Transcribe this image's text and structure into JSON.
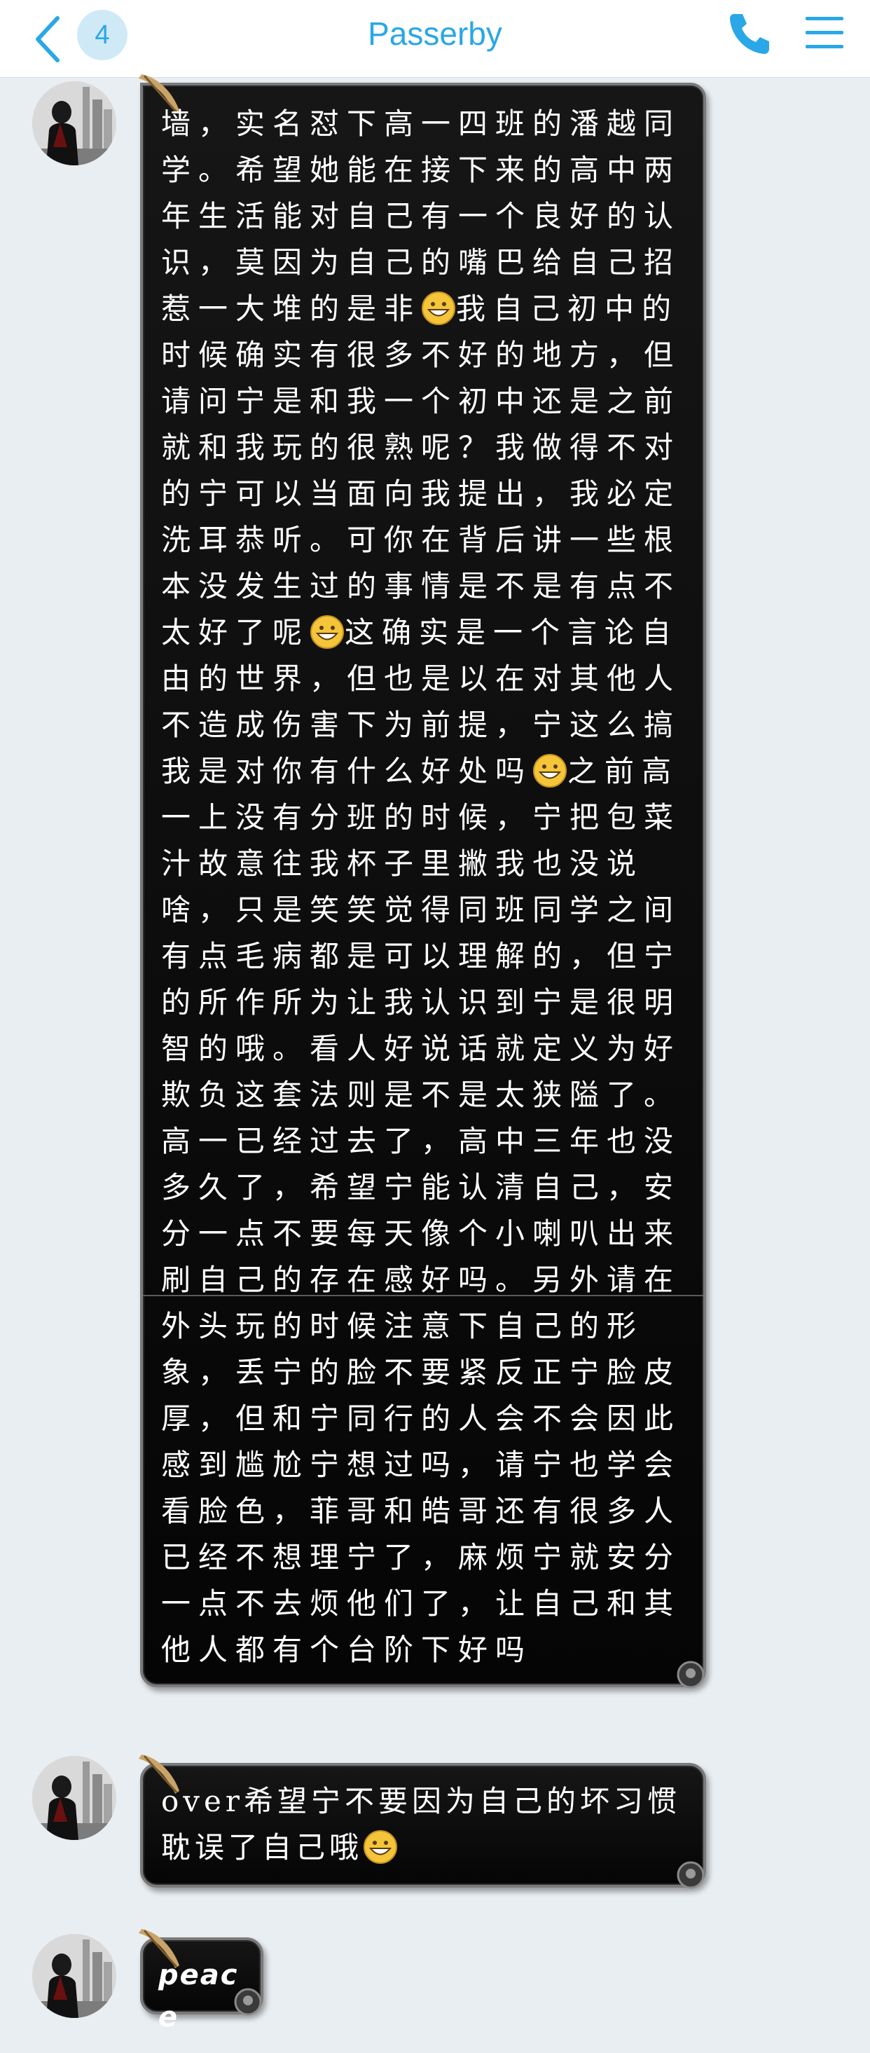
{
  "header": {
    "back_label": "back",
    "unread_count": "4",
    "title": "Passerby",
    "call_label": "call",
    "menu_label": "menu"
  },
  "messages": [
    {
      "sender": "contact",
      "segments": [
        "墙，实名怼下高一四班的潘越同学。希望她能在接下来的高中两年生活能对自己有一个良好的认识，莫因为自己的嘴巴给自己招惹一大堆的是非",
        "我自己初中的时候确实有很多不好的地方，但请问宁是和我一个初中还是之前就和我玩的很熟呢？我做得不对的宁可以当面向我提出，我必定洗耳恭听。可你在背后讲一些根本没发生过的事情是不是有点不太好了呢",
        "这确实是一个言论自由的世界，但也是以在对其他人不造成伤害下为前提，宁这么搞我是对你有什么好处吗",
        "之前高一上没有分班的时候，宁把包菜汁故意往我杯子里撇我也没说啥，只是笑笑觉得同班同学之间有点毛病都是可以理解的，但宁的所作所为让我认识到宁是很明智的哦。看人好说话就定义为好欺负这套法则是不是太狭隘了。高一已经过去了，高中三年也没多久了，希望宁能认清自己，安分一点不要每天像个小喇叭出来刷自己的存在感好吗。另外请在外头玩的时候注意下自己的形象，丢宁的脸不要紧反正宁脸皮厚，但和宁同行的人会不会因此感到尴尬宁想过吗，请宁也学会看脸色，菲哥和皓哥还有很多人已经不想理宁了，麻烦宁就安分一点不去烦他们了，让自己和其他人都有个台阶下好吗"
      ],
      "emoji": "grinning-face"
    },
    {
      "sender": "contact",
      "segments": [
        "over希望宁不要因为自己的坏习惯耽误了自己哦",
        ""
      ],
      "emoji": "grinning-face"
    },
    {
      "sender": "contact",
      "segments": [
        "peace"
      ]
    }
  ],
  "colors": {
    "accent": "#2aa7e6",
    "bubble": "#0a0a0a",
    "background": "#e9eef2"
  }
}
